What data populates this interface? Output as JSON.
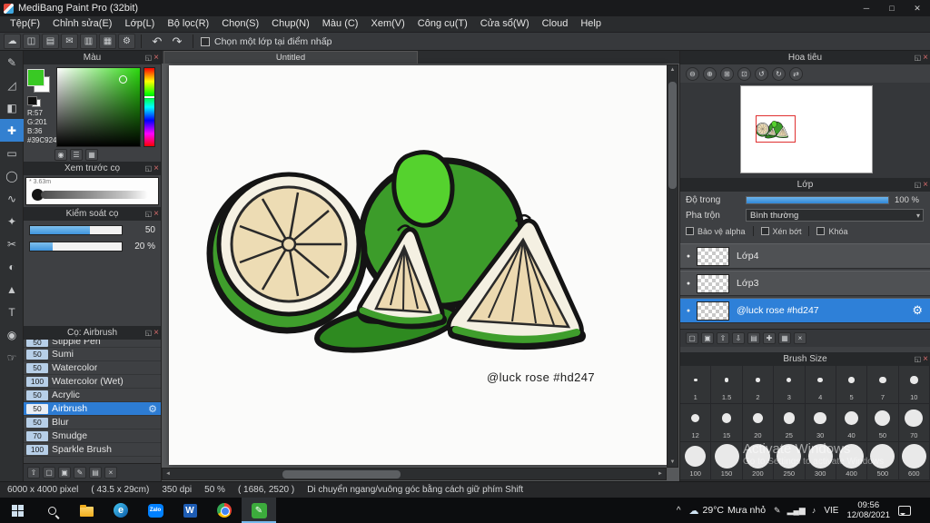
{
  "ui": {
    "popout": "◱",
    "close": "×",
    "caret": "▾",
    "eye": "●",
    "gear": "⚙",
    "arrow_up": "▲",
    "arrow_down": "▼",
    "arrow_left": "◄",
    "arrow_right": "►"
  },
  "titlebar": {
    "app_title": "MediBang Paint Pro (32bit)",
    "minimize": "─",
    "maximize": "□",
    "close": "✕"
  },
  "menubar": {
    "items": [
      "Tệp(F)",
      "Chỉnh sửa(E)",
      "Lớp(L)",
      "Bộ lọc(R)",
      "Chọn(S)",
      "Chụp(N)",
      "Màu (C)",
      "Xem(V)",
      "Công cụ(T)",
      "Cửa sổ(W)",
      "Cloud",
      "Help"
    ]
  },
  "toolbar": {
    "icons": [
      {
        "name": "cloud-icon",
        "glyph": "☁"
      },
      {
        "name": "open-file-icon",
        "glyph": "◫"
      },
      {
        "name": "save-icon",
        "glyph": "▤"
      },
      {
        "name": "message-icon",
        "glyph": "✉"
      },
      {
        "name": "export-icon",
        "glyph": "▥"
      },
      {
        "name": "grid-view-icon",
        "glyph": "▦"
      },
      {
        "name": "settings-icon",
        "glyph": "⚙"
      }
    ],
    "undo": "↶",
    "redo": "↷",
    "snap_label": "Chọn một lớp tại điểm nhấp"
  },
  "tool_strip": {
    "active_index": 3,
    "tools": [
      {
        "name": "pen-tool",
        "glyph": "✎"
      },
      {
        "name": "eraser-tool",
        "glyph": "◿"
      },
      {
        "name": "bucket-tool",
        "glyph": "◧"
      },
      {
        "name": "move-tool",
        "glyph": "✚"
      },
      {
        "name": "select-rect-tool",
        "glyph": "▭"
      },
      {
        "name": "select-ellipse-tool",
        "glyph": "◯"
      },
      {
        "name": "lasso-tool",
        "glyph": "∿"
      },
      {
        "name": "magic-wand-tool",
        "glyph": "✦"
      },
      {
        "name": "divide-tool",
        "glyph": "✂"
      },
      {
        "name": "gradient-tool",
        "glyph": "◐"
      },
      {
        "name": "shape-tool",
        "glyph": "▲"
      },
      {
        "name": "text-tool",
        "glyph": "T"
      },
      {
        "name": "eyedropper-tool",
        "glyph": "◉"
      },
      {
        "name": "hand-tool",
        "glyph": "☞"
      }
    ]
  },
  "color_panel": {
    "title": "Màu",
    "r": "R:57",
    "g": "G:201",
    "b": "B:36",
    "hex": "#39C924",
    "selected_color": "#39C924",
    "footer_icons": [
      {
        "name": "eyedropper-icon",
        "glyph": "◉"
      },
      {
        "name": "sliders-icon",
        "glyph": "☰"
      },
      {
        "name": "palette-grid-icon",
        "glyph": "▦"
      }
    ]
  },
  "brush_preview_panel": {
    "title": "Xem trước cọ",
    "size_note": "* 3.63m"
  },
  "brush_control_panel": {
    "title": "Kiểm soát cọ",
    "slider1": {
      "value": "50",
      "fill": 0.65
    },
    "slider2": {
      "value": "20 %",
      "fill": 0.25
    }
  },
  "brush_panel": {
    "title": "Cọ: Airbrush",
    "brushes": [
      {
        "size": "50",
        "name": "Stipple Pen",
        "partial": true
      },
      {
        "size": "50",
        "name": "Sumi"
      },
      {
        "size": "50",
        "name": "Watercolor"
      },
      {
        "size": "100",
        "name": "Watercolor (Wet)"
      },
      {
        "size": "50",
        "name": "Acrylic"
      },
      {
        "size": "50",
        "name": "Airbrush",
        "selected": true
      },
      {
        "size": "50",
        "name": "Blur"
      },
      {
        "size": "70",
        "name": "Smudge"
      },
      {
        "size": "100",
        "name": "Sparkle Brush"
      }
    ],
    "footer_icons": [
      {
        "name": "brush-up-icon",
        "glyph": "⇧"
      },
      {
        "name": "add-brush-icon",
        "glyph": "▢"
      },
      {
        "name": "duplicate-brush-icon",
        "glyph": "▣"
      },
      {
        "name": "edit-brush-icon",
        "glyph": "✎"
      },
      {
        "name": "brush-folder-icon",
        "glyph": "▤"
      },
      {
        "name": "delete-brush-icon",
        "glyph": "×"
      }
    ]
  },
  "canvas": {
    "tab_title": "Untitled",
    "signature": "@luck rose #hd247"
  },
  "navigator_panel": {
    "title": "Hoa tiêu",
    "icons": [
      {
        "name": "zoom-out-icon",
        "glyph": "⊖"
      },
      {
        "name": "zoom-in-icon",
        "glyph": "⊕"
      },
      {
        "name": "fit-view-icon",
        "glyph": "⊞"
      },
      {
        "name": "zoom-reset-icon",
        "glyph": "⊡"
      },
      {
        "name": "rotate-ccw-icon",
        "glyph": "↺"
      },
      {
        "name": "rotate-cw-icon",
        "glyph": "↻"
      },
      {
        "name": "flip-icon",
        "glyph": "⇄"
      }
    ]
  },
  "layer_panel": {
    "title": "Lớp",
    "opacity_label": "Độ trong",
    "opacity_value": "100 %",
    "opacity_fill": 1,
    "blend_label": "Pha trộn",
    "blend_value": "Bình thường",
    "protect_alpha_label": "Bảo vệ alpha",
    "clipping_label": "Xén bớt",
    "lock_label": "Khóa",
    "layers": [
      {
        "name": "Lớp4"
      },
      {
        "name": "Lớp3"
      },
      {
        "name": "@luck rose #hd247",
        "selected": true
      }
    ],
    "footer_icons": [
      {
        "name": "add-layer-icon",
        "glyph": "▢"
      },
      {
        "name": "duplicate-layer-icon",
        "glyph": "▣"
      },
      {
        "name": "layer-up-icon",
        "glyph": "⇧"
      },
      {
        "name": "layer-down-icon",
        "glyph": "⇩"
      },
      {
        "name": "layer-folder-icon",
        "glyph": "▤"
      },
      {
        "name": "merge-layer-icon",
        "glyph": "✚"
      },
      {
        "name": "layer-grid-icon",
        "glyph": "▦"
      },
      {
        "name": "delete-layer-icon",
        "glyph": "×"
      }
    ]
  },
  "brush_size_panel": {
    "title": "Brush Size",
    "sizes": [
      "1",
      "1.5",
      "2",
      "3",
      "4",
      "5",
      "7",
      "10",
      "12",
      "15",
      "20",
      "25",
      "30",
      "40",
      "50",
      "70",
      "100",
      "150",
      "200",
      "250",
      "300",
      "400",
      "500",
      "600"
    ]
  },
  "status_bar": {
    "segments": [
      "6000 x 4000 pixel",
      "( 43.5 x 29cm)",
      "350 dpi",
      "50 %",
      "( 1686, 2520 )",
      "Di chuyển ngang/vuông góc bằng cách giữ phím Shift"
    ]
  },
  "watermark": {
    "line1": "Activate Windows",
    "line2": "Go to Settings to activate Windows"
  },
  "taskbar": {
    "edge_letter": "e",
    "zalo_label": "Zalo",
    "word_letter": "W",
    "medibang_glyph": "✎",
    "tray_expand": "^",
    "weather_icon": "☁",
    "weather_temp": "29°C",
    "weather_desc": "Mưa nhỏ",
    "tray_icons": [
      "✎",
      "▂▄▆",
      "♪"
    ],
    "language": "VIE",
    "time": "09:56",
    "date": "12/08/2021"
  }
}
